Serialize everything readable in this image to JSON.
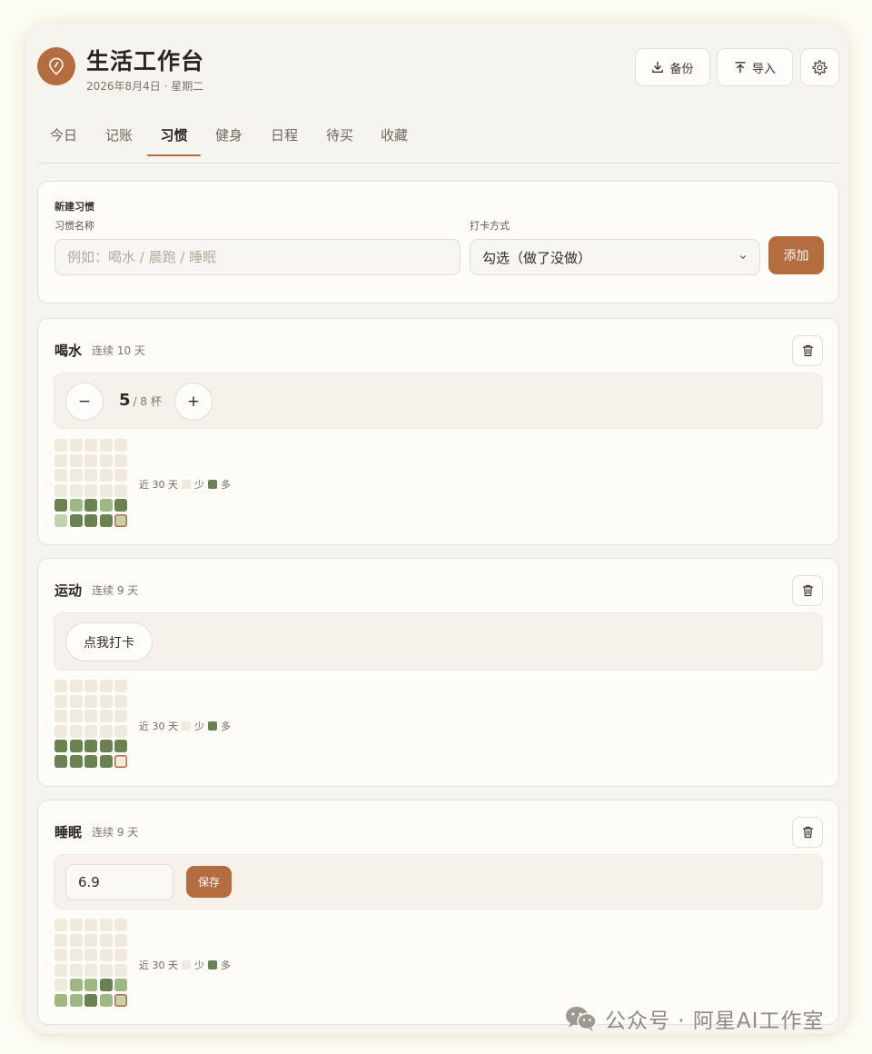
{
  "header": {
    "title": "生活工作台",
    "date": "2026年8月4日 · 星期二",
    "backup_label": "备份",
    "import_label": "导入"
  },
  "tabs": [
    {
      "label": "今日",
      "active": false
    },
    {
      "label": "记账",
      "active": false
    },
    {
      "label": "习惯",
      "active": true
    },
    {
      "label": "健身",
      "active": false
    },
    {
      "label": "日程",
      "active": false
    },
    {
      "label": "待买",
      "active": false
    },
    {
      "label": "收藏",
      "active": false
    }
  ],
  "new_habit": {
    "section_title": "新建习惯",
    "name_label": "习惯名称",
    "name_placeholder": "例如：喝水 / 晨跑 / 睡眠",
    "mode_label": "打卡方式",
    "mode_value": "勾选（做了没做）",
    "add_label": "添加"
  },
  "legend": {
    "prefix": "近 30 天",
    "low": "少",
    "high": "多"
  },
  "habits": [
    {
      "name": "喝水",
      "streak": "连续 10 天",
      "count": "5",
      "goal": "/ 8 杯",
      "minus": "−",
      "plus": "+",
      "heatmap": [
        0,
        0,
        0,
        0,
        0,
        0,
        0,
        0,
        0,
        0,
        0,
        0,
        0,
        0,
        0,
        0,
        0,
        0,
        0,
        0,
        3,
        2,
        3,
        2,
        3,
        1,
        3,
        3,
        3,
        1
      ]
    },
    {
      "name": "运动",
      "streak": "连续 9 天",
      "checkin_label": "点我打卡",
      "heatmap": [
        0,
        0,
        0,
        0,
        0,
        0,
        0,
        0,
        0,
        0,
        0,
        0,
        0,
        0,
        0,
        0,
        0,
        0,
        0,
        0,
        3,
        3,
        3,
        3,
        3,
        3,
        3,
        3,
        3,
        0
      ]
    },
    {
      "name": "睡眠",
      "streak": "连续 9 天",
      "value": "6.9",
      "save_label": "保存",
      "heatmap": [
        0,
        0,
        0,
        0,
        0,
        0,
        0,
        0,
        0,
        0,
        0,
        0,
        0,
        0,
        0,
        0,
        0,
        0,
        0,
        0,
        0,
        2,
        2,
        3,
        2,
        2,
        2,
        3,
        2,
        1
      ]
    }
  ],
  "heat_colors": {
    "empty": "#efe9de",
    "l1": "#c3d2ad",
    "l2": "#9fb881",
    "l3": "#6b8152",
    "accent": "#b56d3f"
  },
  "watermark": "公众号 · 阿星AI工作室"
}
